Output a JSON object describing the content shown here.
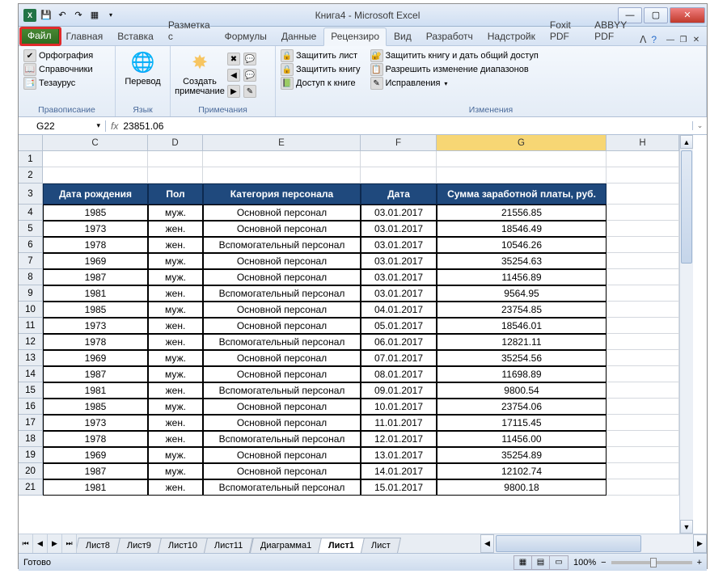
{
  "titlebar": {
    "title": "Книга4  -  Microsoft Excel"
  },
  "tabs": {
    "file": "Файл",
    "list": [
      "Главная",
      "Вставка",
      "Разметка с",
      "Формулы",
      "Данные",
      "Рецензиро",
      "Вид",
      "Разработч",
      "Надстройк",
      "Foxit PDF",
      "ABBYY PDF"
    ],
    "active_index": 5
  },
  "ribbon": {
    "proofing": {
      "label": "Правописание",
      "spelling": "Орфография",
      "research": "Справочники",
      "thesaurus": "Тезаурус"
    },
    "language": {
      "label": "Язык",
      "translate": "Перевод"
    },
    "comments": {
      "label": "Примечания",
      "new_comment": "Создать\nпримечание"
    },
    "changes": {
      "label": "Изменения",
      "protect_sheet": "Защитить лист",
      "protect_book": "Защитить книгу",
      "share_book": "Доступ к книге",
      "protect_share": "Защитить книгу и дать общий доступ",
      "allow_ranges": "Разрешить изменение диапазонов",
      "track": "Исправления"
    }
  },
  "formula_bar": {
    "cell_ref": "G22",
    "value": "23851.06"
  },
  "columns": [
    "C",
    "D",
    "E",
    "F",
    "G",
    "H"
  ],
  "selected_col": "G",
  "row_numbers": [
    1,
    2,
    3,
    4,
    5,
    6,
    7,
    8,
    9,
    10,
    11,
    12,
    13,
    14,
    15,
    16,
    17,
    18,
    19,
    20,
    21
  ],
  "table": {
    "headers": [
      "Дата рождения",
      "Пол",
      "Категория персонала",
      "Дата",
      "Сумма заработной платы, руб."
    ],
    "rows": [
      [
        "1985",
        "муж.",
        "Основной персонал",
        "03.01.2017",
        "21556.85"
      ],
      [
        "1973",
        "жен.",
        "Основной персонал",
        "03.01.2017",
        "18546.49"
      ],
      [
        "1978",
        "жен.",
        "Вспомогательный персонал",
        "03.01.2017",
        "10546.26"
      ],
      [
        "1969",
        "муж.",
        "Основной персонал",
        "03.01.2017",
        "35254.63"
      ],
      [
        "1987",
        "муж.",
        "Основной персонал",
        "03.01.2017",
        "11456.89"
      ],
      [
        "1981",
        "жен.",
        "Вспомогательный персонал",
        "03.01.2017",
        "9564.95"
      ],
      [
        "1985",
        "муж.",
        "Основной персонал",
        "04.01.2017",
        "23754.85"
      ],
      [
        "1973",
        "жен.",
        "Основной персонал",
        "05.01.2017",
        "18546.01"
      ],
      [
        "1978",
        "жен.",
        "Вспомогательный персонал",
        "06.01.2017",
        "12821.11"
      ],
      [
        "1969",
        "муж.",
        "Основной персонал",
        "07.01.2017",
        "35254.56"
      ],
      [
        "1987",
        "муж.",
        "Основной персонал",
        "08.01.2017",
        "11698.89"
      ],
      [
        "1981",
        "жен.",
        "Вспомогательный персонал",
        "09.01.2017",
        "9800.54"
      ],
      [
        "1985",
        "муж.",
        "Основной персонал",
        "10.01.2017",
        "23754.06"
      ],
      [
        "1973",
        "жен.",
        "Основной персонал",
        "11.01.2017",
        "17115.45"
      ],
      [
        "1978",
        "жен.",
        "Вспомогательный персонал",
        "12.01.2017",
        "11456.00"
      ],
      [
        "1969",
        "муж.",
        "Основной персонал",
        "13.01.2017",
        "35254.89"
      ],
      [
        "1987",
        "муж.",
        "Основной персонал",
        "14.01.2017",
        "12102.74"
      ],
      [
        "1981",
        "жен.",
        "Вспомогательный персонал",
        "15.01.2017",
        "9800.18"
      ]
    ]
  },
  "sheets": {
    "list": [
      "Лист8",
      "Лист9",
      "Лист10",
      "Лист11",
      "Диаграмма1",
      "Лист1",
      "Лист"
    ],
    "active_index": 5
  },
  "statusbar": {
    "ready": "Готово",
    "zoom": "100%"
  }
}
